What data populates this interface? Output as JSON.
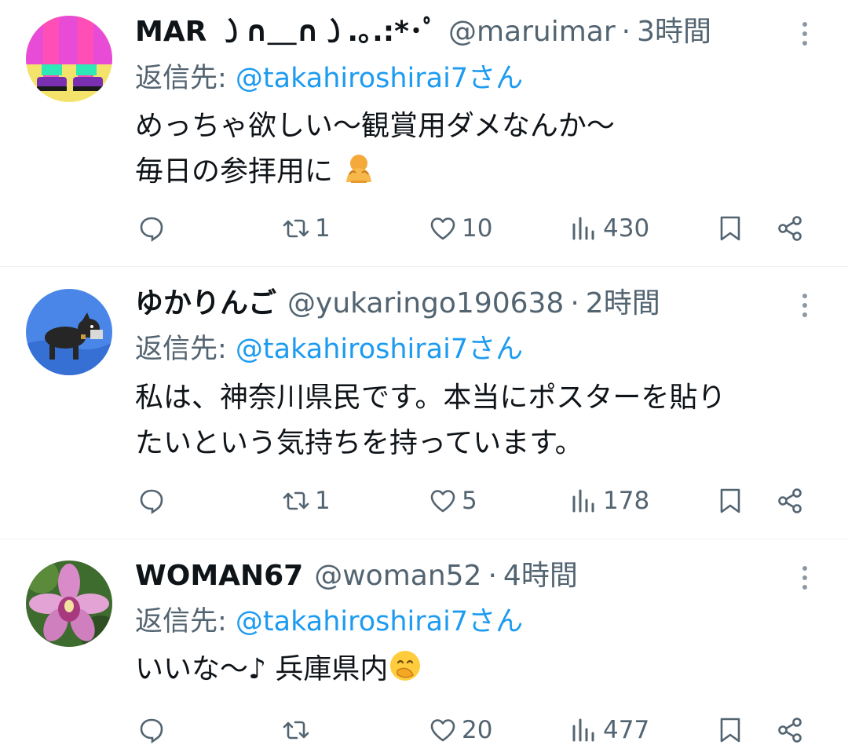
{
  "tweets": [
    {
      "name": "MAR ㇁∩＿∩㇁.｡.:*･ﾟ",
      "handle": "@maruimar",
      "time": "3時間",
      "reply_prefix": "返信先: ",
      "reply_mention": "@takahiroshirai7さん",
      "lines": [
        "めっちゃ欲しい〜観賞用ダメなんか〜",
        "毎日の参拝用に"
      ],
      "trailing_emoji": "person-bowing-emoji",
      "stats": {
        "replies": "",
        "retweets": "1",
        "likes": "10",
        "views": "430"
      },
      "avatar": "legs-in-pink-tights-avatar"
    },
    {
      "name": "ゆかりんご",
      "handle": "@yukaringo190638",
      "time": "2時間",
      "reply_prefix": "返信先: ",
      "reply_mention": "@takahiroshirai7さん",
      "lines": [
        "私は、神奈川県民です。本当にポスターを貼り",
        "たいという気持ちを持っています。"
      ],
      "trailing_emoji": "",
      "stats": {
        "replies": "",
        "retweets": "1",
        "likes": "5",
        "views": "178"
      },
      "avatar": "schnauzer-dog-avatar"
    },
    {
      "name": "WOMAN67",
      "handle": "@woman52",
      "time": "4時間",
      "reply_prefix": "返信先: ",
      "reply_mention": "@takahiroshirai7さん",
      "lines": [
        "いいな〜♪ 兵庫県内"
      ],
      "trailing_emoji": "face-with-hand-over-mouth-emoji",
      "stats": {
        "replies": "",
        "retweets": "",
        "likes": "20",
        "views": "477"
      },
      "avatar": "pink-orchid-avatar"
    }
  ],
  "colors": {
    "text": "#0f1419",
    "secondary": "#536471",
    "link": "#1d9bf0",
    "divider": "#eff3f4"
  },
  "icons": [
    "reply-icon",
    "retweet-icon",
    "like-icon",
    "views-icon",
    "bookmark-icon",
    "share-icon",
    "more-icon"
  ]
}
